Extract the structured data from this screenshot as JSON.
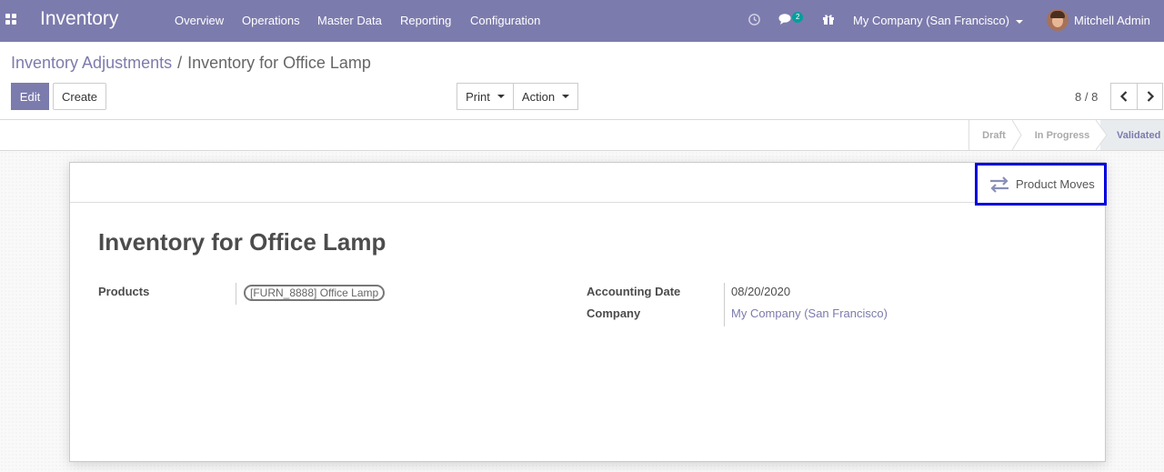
{
  "navbar": {
    "app_title": "Inventory",
    "menu": [
      "Overview",
      "Operations",
      "Master Data",
      "Reporting",
      "Configuration"
    ],
    "chat_badge": "2",
    "company": "My Company (San Francisco)",
    "user": "Mitchell Admin",
    "icons": [
      "apps-grid-icon",
      "clock-icon",
      "chat-icon",
      "gift-icon"
    ]
  },
  "breadcrumb": {
    "parent": "Inventory Adjustments",
    "separator": "/",
    "current": "Inventory for Office Lamp"
  },
  "buttons": {
    "edit": "Edit",
    "create": "Create",
    "print": "Print",
    "action": "Action"
  },
  "pager": {
    "value": "8 / 8"
  },
  "statusbar": {
    "stages": [
      "Draft",
      "In Progress",
      "Validated"
    ],
    "current": "Validated"
  },
  "smart_button": {
    "label": "Product Moves",
    "icon": "exchange-arrows-icon"
  },
  "form": {
    "title": "Inventory for Office Lamp",
    "products_label": "Products",
    "product_tag": "[FURN_8888] Office Lamp",
    "accounting_date_label": "Accounting Date",
    "accounting_date": "08/20/2020",
    "company_label": "Company",
    "company": "My Company (San Francisco)"
  },
  "colors": {
    "brand": "#7c7bad",
    "highlight": "#0000e0",
    "badge": "#00a09d"
  }
}
